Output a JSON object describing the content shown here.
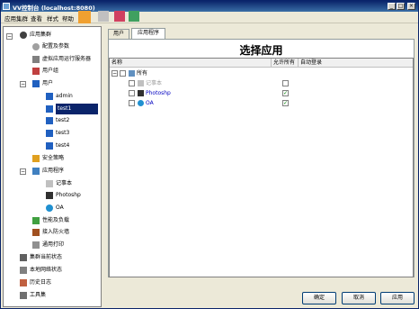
{
  "window": {
    "title": "VV控制台 (localhost:8080)"
  },
  "menu": [
    "应用集群",
    "查看",
    "样式",
    "帮助"
  ],
  "tree": {
    "root": "应用集群",
    "config": "配置及参数",
    "vservers": "虚拟应用运行服务器",
    "usergroup": "用户组",
    "users": "用户",
    "user_items": [
      "admin",
      "test1",
      "test2",
      "test3",
      "test4"
    ],
    "security": "安全策略",
    "apps": "应用程序",
    "app_items": [
      "记事本",
      "Photoshp",
      "OA"
    ],
    "perf": "性能及负载",
    "firewall": "接入防火墙",
    "print": "通用打印",
    "cluster_status": "集群当前状态",
    "net_status": "本地网络状态",
    "history": "历史日志",
    "tools": "工具集"
  },
  "tabs": [
    "用户",
    "应用程序"
  ],
  "panel": {
    "title": "选择应用",
    "columns": [
      "名称",
      "允许所有",
      "自动登录"
    ],
    "root_label": "所有",
    "rows": [
      {
        "name": "记事本",
        "allow": false,
        "auto": false
      },
      {
        "name": "Photoshp",
        "allow": false,
        "auto": true
      },
      {
        "name": "OA",
        "allow": false,
        "auto": true
      }
    ]
  },
  "buttons": {
    "ok": "确定",
    "cancel": "取消",
    "apply": "应用"
  },
  "colors": {
    "selection": "#0a246a",
    "title_bar": "#0a246a"
  },
  "icons": [
    "cluster-icon",
    "gear-icon",
    "server-icon",
    "user-icon",
    "shield-icon",
    "app-icon"
  ]
}
